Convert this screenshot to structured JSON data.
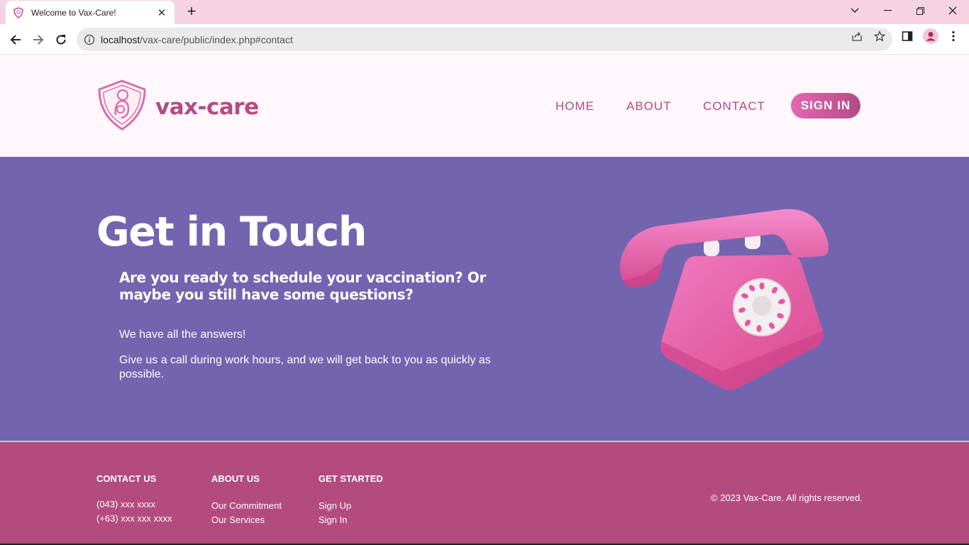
{
  "browser": {
    "tab_title": "Welcome to Vax-Care!",
    "url_host": "localhost",
    "url_path": "/vax-care/public/index.php#contact",
    "new_tab_label": "+",
    "close_tab_label": "✕"
  },
  "header": {
    "logo_text": "vax-care",
    "nav": {
      "home": "HOME",
      "about": "ABOUT",
      "contact": "CONTACT"
    },
    "signin": "SIGN IN"
  },
  "contact": {
    "title": "Get in Touch",
    "subtitle": "Are you ready to schedule your vaccination? Or maybe you still have some questions?",
    "line1": "We have all the answers!",
    "line2": "Give us a call during work hours, and we will get back to you as quickly as possible."
  },
  "footer": {
    "contact_us": {
      "heading": "CONTACT US",
      "items": [
        "(043) xxx xxxx",
        "(+63) xxx xxx xxxx"
      ]
    },
    "about_us": {
      "heading": "ABOUT US",
      "items": [
        "Our Commitment",
        "Our Services"
      ]
    },
    "get_started": {
      "heading": "GET STARTED",
      "items": [
        "Sign Up",
        "Sign In"
      ]
    },
    "copyright": "© 2023 Vax-Care. All rights reserved."
  },
  "colors": {
    "brand_pink": "#b44b84",
    "hero_purple": "#7364b0",
    "footer_pink": "#b44b7e",
    "tab_strip": "#f6d3e3"
  }
}
